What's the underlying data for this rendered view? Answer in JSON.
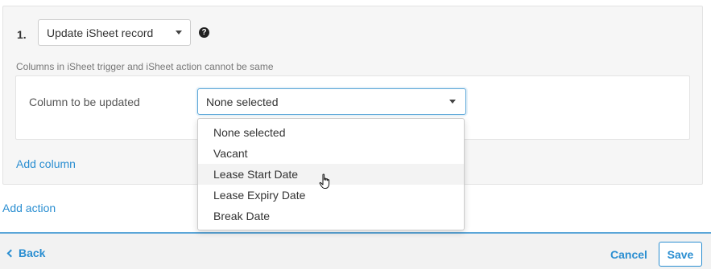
{
  "action": {
    "step_number": "1.",
    "select_value": "Update iSheet record",
    "help_icon": "?",
    "note": "Columns in iSheet trigger and iSheet action cannot be same"
  },
  "column_mapping": {
    "label": "Column to be updated",
    "select_value": "None selected"
  },
  "dropdown": {
    "options": [
      "None selected",
      "Vacant",
      "Lease Start Date",
      "Lease Expiry Date",
      "Break Date"
    ],
    "hovered": "Lease Start Date"
  },
  "links": {
    "add_column": "Add column",
    "add_action": "Add action"
  },
  "footer": {
    "back_label": "Back",
    "cancel_label": "Cancel",
    "save_label": "Save"
  },
  "colors": {
    "accent": "#2a8ed1",
    "focus_border": "#5ba6d8",
    "panel_bg": "#f6f6f6",
    "footer_bg": "#f2f2f2"
  }
}
